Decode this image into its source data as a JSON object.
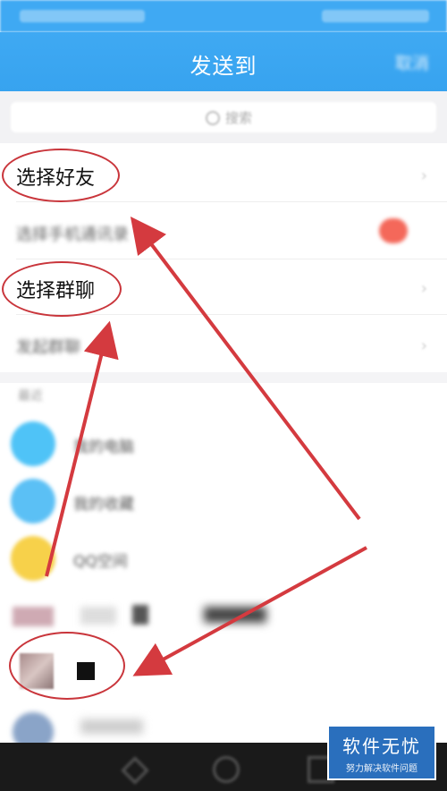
{
  "header": {
    "title": "发送到",
    "action_label": "取消"
  },
  "search": {
    "placeholder": "搜索"
  },
  "menu": {
    "select_friends": "选择好友",
    "select_phone_contacts": "选择手机通讯录",
    "select_group_chat": "选择群聊",
    "create_group_chat": "发起群聊"
  },
  "section_recent": "最近",
  "contacts": [
    {
      "name": "我的电脑",
      "color": "#4fc3f7"
    },
    {
      "name": "我的收藏",
      "color": "#5bc0f5"
    },
    {
      "name": "QQ空间",
      "color": "#f7d14a"
    }
  ],
  "watermark": {
    "main": "软件无忧",
    "sub": "努力解决软件问题"
  },
  "colors": {
    "header_blue": "#3fa9f3",
    "annotation_red": "#d43a3f",
    "badge_red": "#f4685a"
  }
}
